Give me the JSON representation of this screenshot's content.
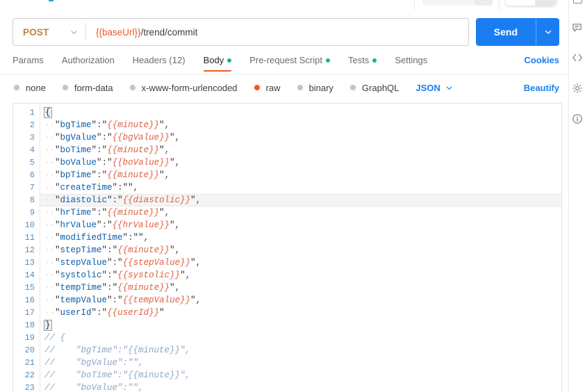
{
  "request": {
    "method": "POST",
    "url_variable": "{{baseUrl}}",
    "url_path": "/trend/commit",
    "send_label": "Send"
  },
  "tabs": [
    {
      "label": "Params",
      "active": false,
      "dot": false
    },
    {
      "label": "Authorization",
      "active": false,
      "dot": false
    },
    {
      "label": "Headers (12)",
      "active": false,
      "dot": false
    },
    {
      "label": "Body",
      "active": true,
      "dot": true
    },
    {
      "label": "Pre-request Script",
      "active": false,
      "dot": true
    },
    {
      "label": "Tests",
      "active": false,
      "dot": true
    },
    {
      "label": "Settings",
      "active": false,
      "dot": false
    }
  ],
  "cookies_label": "Cookies",
  "body_types": [
    {
      "label": "none",
      "selected": false
    },
    {
      "label": "form-data",
      "selected": false
    },
    {
      "label": "x-www-form-urlencoded",
      "selected": false
    },
    {
      "label": "raw",
      "selected": true
    },
    {
      "label": "binary",
      "selected": false
    },
    {
      "label": "GraphQL",
      "selected": false
    }
  ],
  "format_select": "JSON",
  "beautify_label": "Beautify",
  "colors": {
    "accent_orange": "#ef5b25",
    "send_blue": "#1a7ef2",
    "method_amber": "#b5883a",
    "dot_green": "#14b881",
    "variable_red": "#e0603f",
    "json_key_blue": "#0b5ca8",
    "comment_blue": "#8fa6c4"
  },
  "editor": {
    "active_line": 8,
    "line_count": 23,
    "lines": [
      {
        "n": 1,
        "type": "brace-open",
        "text": "{"
      },
      {
        "n": 2,
        "type": "kv-var",
        "key": "bgTime",
        "value": "{{minute}}",
        "comma": true
      },
      {
        "n": 3,
        "type": "kv-var",
        "key": "bgValue",
        "value": "{{bgValue}}",
        "comma": true
      },
      {
        "n": 4,
        "type": "kv-var",
        "key": "boTime",
        "value": "{{minute}}",
        "comma": true
      },
      {
        "n": 5,
        "type": "kv-var",
        "key": "boValue",
        "value": "{{boValue}}",
        "comma": true
      },
      {
        "n": 6,
        "type": "kv-var",
        "key": "bpTime",
        "value": "{{minute}}",
        "comma": true
      },
      {
        "n": 7,
        "type": "kv-empty",
        "key": "createTime",
        "value": "",
        "comma": true
      },
      {
        "n": 8,
        "type": "kv-var",
        "key": "diastolic",
        "value": "{{diastolic}}",
        "comma": true
      },
      {
        "n": 9,
        "type": "kv-var",
        "key": "hrTime",
        "value": "{{minute}}",
        "comma": true
      },
      {
        "n": 10,
        "type": "kv-var",
        "key": "hrValue",
        "value": "{{hrValue}}",
        "comma": true
      },
      {
        "n": 11,
        "type": "kv-empty",
        "key": "modifiedTime",
        "value": "",
        "comma": true
      },
      {
        "n": 12,
        "type": "kv-var",
        "key": "stepTime",
        "value": "{{minute}}",
        "comma": true
      },
      {
        "n": 13,
        "type": "kv-var",
        "key": "stepValue",
        "value": "{{stepValue}}",
        "comma": true
      },
      {
        "n": 14,
        "type": "kv-var",
        "key": "systolic",
        "value": "{{systolic}}",
        "comma": true
      },
      {
        "n": 15,
        "type": "kv-var",
        "key": "tempTime",
        "value": "{{minute}}",
        "comma": true
      },
      {
        "n": 16,
        "type": "kv-var",
        "key": "tempValue",
        "value": "{{tempValue}}",
        "comma": true
      },
      {
        "n": 17,
        "type": "kv-var",
        "key": "userId",
        "value": "{{userId}}",
        "comma": false
      },
      {
        "n": 18,
        "type": "brace-close",
        "text": "}"
      },
      {
        "n": 19,
        "type": "comment",
        "text": "// {"
      },
      {
        "n": 20,
        "type": "comment",
        "text": "//    \"bgTime\":\"{{minute}}\","
      },
      {
        "n": 21,
        "type": "comment",
        "text": "//    \"bgValue\":\"\","
      },
      {
        "n": 22,
        "type": "comment",
        "text": "//    \"boTime\":\"{{minute}}\","
      },
      {
        "n": 23,
        "type": "comment",
        "text": "//    \"boValue\":\"\","
      }
    ]
  },
  "rail_icons": [
    {
      "name": "comment-icon"
    },
    {
      "name": "code-icon"
    },
    {
      "name": "gear-icon"
    },
    {
      "name": "info-icon"
    }
  ]
}
